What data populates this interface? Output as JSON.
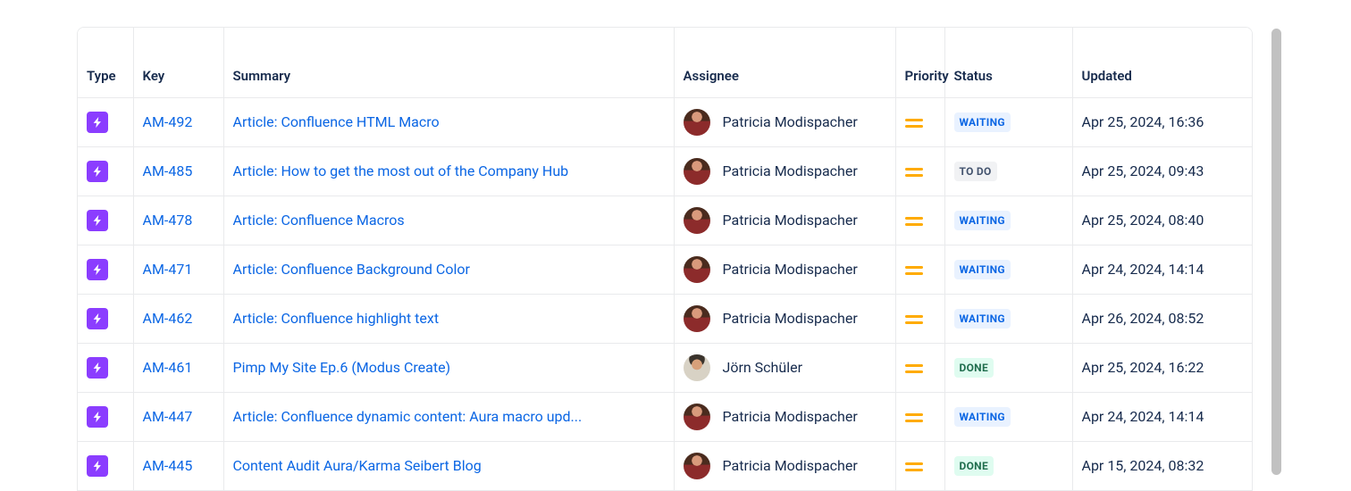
{
  "columns": {
    "type": "Type",
    "key": "Key",
    "summary": "Summary",
    "assignee": "Assignee",
    "priority": "Priority",
    "status": "Status",
    "updated": "Updated"
  },
  "status_styles": {
    "WAITING": "loz-waiting",
    "TO DO": "loz-todo",
    "DONE": "loz-done"
  },
  "rows": [
    {
      "key": "AM-492",
      "summary": "Article: Confluence HTML Macro",
      "assignee": "Patricia Modispacher",
      "avatar": "f",
      "priority": "medium",
      "status": "WAITING",
      "updated": "Apr 25, 2024, 16:36"
    },
    {
      "key": "AM-485",
      "summary": "Article: How to get the most out of the Company Hub",
      "assignee": "Patricia Modispacher",
      "avatar": "f",
      "priority": "medium",
      "status": "TO DO",
      "updated": "Apr 25, 2024, 09:43"
    },
    {
      "key": "AM-478",
      "summary": "Article: Confluence Macros",
      "assignee": "Patricia Modispacher",
      "avatar": "f",
      "priority": "medium",
      "status": "WAITING",
      "updated": "Apr 25, 2024, 08:40"
    },
    {
      "key": "AM-471",
      "summary": "Article: Confluence Background Color",
      "assignee": "Patricia Modispacher",
      "avatar": "f",
      "priority": "medium",
      "status": "WAITING",
      "updated": "Apr 24, 2024, 14:14"
    },
    {
      "key": "AM-462",
      "summary": "Article: Confluence highlight text",
      "assignee": "Patricia Modispacher",
      "avatar": "f",
      "priority": "medium",
      "status": "WAITING",
      "updated": "Apr 26, 2024, 08:52"
    },
    {
      "key": "AM-461",
      "summary": "Pimp My Site Ep.6 (Modus Create)",
      "assignee": "Jörn Schüler",
      "avatar": "m",
      "priority": "medium",
      "status": "DONE",
      "updated": "Apr 25, 2024, 16:22"
    },
    {
      "key": "AM-447",
      "summary": "Article: Confluence dynamic content: Aura macro upd...",
      "assignee": "Patricia Modispacher",
      "avatar": "f",
      "priority": "medium",
      "status": "WAITING",
      "updated": "Apr 24, 2024, 14:14"
    },
    {
      "key": "AM-445",
      "summary": "Content Audit Aura/Karma Seibert Blog",
      "assignee": "Patricia Modispacher",
      "avatar": "f",
      "priority": "medium",
      "status": "DONE",
      "updated": "Apr 15, 2024, 08:32"
    }
  ]
}
